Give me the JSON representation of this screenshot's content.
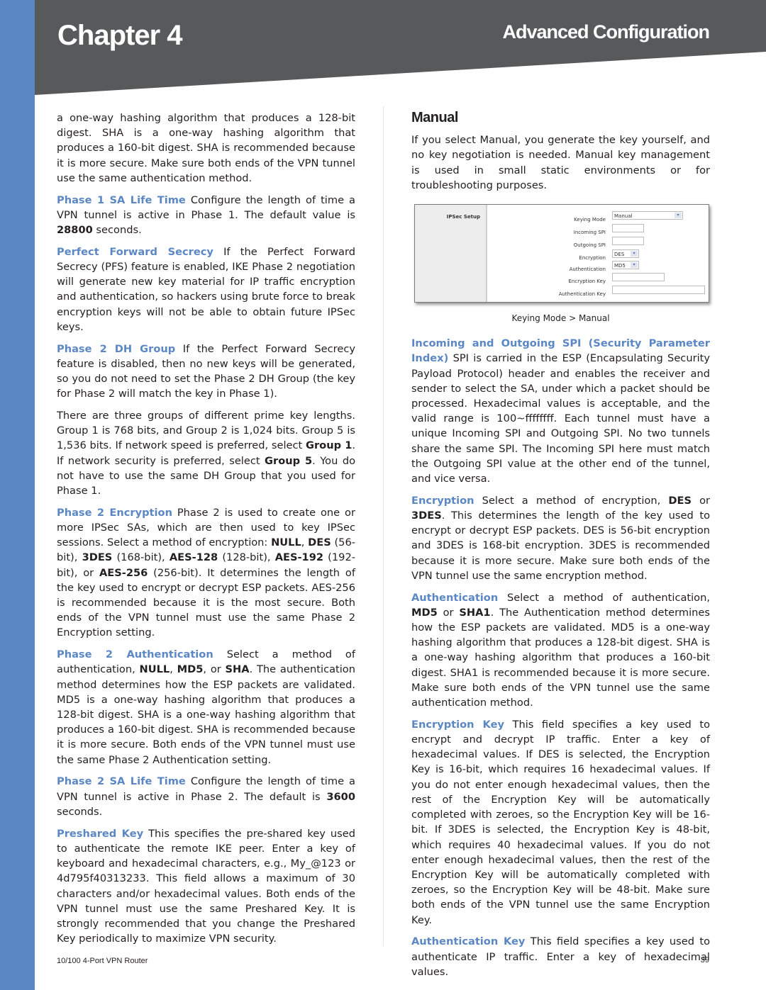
{
  "header": {
    "chapter": "Chapter 4",
    "section": "Advanced Configuration"
  },
  "left": {
    "p0": "a one-way hashing algorithm that produces a 128-bit digest. SHA is a one-way hashing algorithm that produces a 160-bit digest. SHA is recommended because it is more secure. Make sure both ends of the VPN tunnel use the same authentication method.",
    "p1_term": "Phase 1 SA Life Time",
    "p1_a": " Configure the length of time a VPN tunnel is active in Phase 1. The default value is ",
    "p1_b": "28800",
    "p1_c": " seconds.",
    "p2_term": "Perfect Forward Secrecy",
    "p2": " If the Perfect Forward Secrecy (PFS) feature is enabled, IKE Phase 2 negotiation will generate new key material for IP traffic encryption and authentication, so hackers using brute force to break encryption keys will not be able to obtain future IPSec keys.",
    "p3_term": "Phase 2 DH Group",
    "p3": " If the Perfect Forward Secrecy feature is disabled, then no new keys will be generated, so you do not need to set the Phase 2 DH Group (the key for Phase 2 will match the key in Phase 1).",
    "p4_a": "There are three groups of different prime key lengths. Group 1 is 768 bits, and Group 2 is 1,024 bits. Group 5 is 1,536 bits. If network speed is preferred, select ",
    "p4_b": "Group 1",
    "p4_c": ". If network security is preferred, select ",
    "p4_d": "Group 5",
    "p4_e": ". You do not have to use the same DH Group that you used for Phase 1.",
    "p5_term": "Phase 2 Encryption",
    "p5_a": " Phase 2 is used to create one or more IPSec SAs, which are then used to key IPSec sessions. Select a method of encryption: ",
    "p5_null": "NULL",
    "p5_s1": ", ",
    "p5_des": "DES",
    "p5_s2": " (56-bit), ",
    "p5_3des": "3DES",
    "p5_s3": " (168-bit), ",
    "p5_aes128": "AES-128",
    "p5_s4": " (128-bit), ",
    "p5_aes192": "AES-192",
    "p5_s5": " (192-bit), or ",
    "p5_aes256": "AES-256",
    "p5_b": " (256-bit). It determines the length of the key used to encrypt or decrypt ESP packets. AES-256 is recommended because it is the most secure. Both ends of the VPN tunnel must use the same Phase 2 Encryption setting.",
    "p6_term": "Phase 2 Authentication",
    "p6_a": " Select a method of authentication, ",
    "p6_null": "NULL",
    "p6_s1": ", ",
    "p6_md5": "MD5",
    "p6_s2": ", or ",
    "p6_sha": "SHA",
    "p6_b": ". The authentication method determines how the ESP packets are validated. MD5 is a one-way hashing algorithm that produces a 128-bit digest. SHA is a one-way hashing algorithm that produces a 160-bit digest. SHA is recommended because it is more secure. Both ends of the VPN tunnel must use the same Phase 2 Authentication setting.",
    "p7_term": "Phase 2 SA Life Time",
    "p7_a": " Configure the length of time a VPN tunnel is active in Phase 2. The default is ",
    "p7_b": "3600",
    "p7_c": " seconds.",
    "p8_term": "Preshared Key",
    "p8": " This specifies the pre-shared key used to authenticate the remote IKE peer. Enter a key of keyboard and hexadecimal characters, e.g., My_@123 or 4d795f40313233. This field allows a maximum of 30 characters and/or hexadecimal values. Both ends of the VPN tunnel must use the same Preshared Key. It is strongly recommended that you change the Preshared Key periodically to maximize VPN security."
  },
  "right": {
    "heading": "Manual",
    "intro": "If you select Manual, you generate the key yourself, and no key negotiation is needed. Manual key management is used in small static environments or for troubleshooting purposes.",
    "figure": {
      "pane_label": "IPSec Setup",
      "fields": [
        {
          "label": "Keying Mode",
          "value": "Manual"
        },
        {
          "label": "Incoming SPI",
          "value": ""
        },
        {
          "label": "Outgoing SPI",
          "value": ""
        },
        {
          "label": "Encryption",
          "value": "DES"
        },
        {
          "label": "Authentication",
          "value": "MD5"
        },
        {
          "label": "Encryption Key",
          "value": ""
        },
        {
          "label": "Authentication Key",
          "value": ""
        }
      ],
      "caption": "Keying Mode > Manual"
    },
    "r1_term": "Incoming and Outgoing SPI (Security Parameter Index)",
    "r1": " SPI is carried in the ESP (Encapsulating Security Payload Protocol) header and enables the receiver and sender to select the SA, under which a packet should be processed. Hexadecimal values is acceptable, and the valid range is 100~ffffffff. Each tunnel must have a unique Incoming SPI and Outgoing SPI. No two tunnels share the same SPI. The Incoming SPI here must match the Outgoing SPI value at the other end of the tunnel, and vice versa.",
    "r2_term": "Encryption",
    "r2_a": " Select a method of encryption, ",
    "r2_des": "DES",
    "r2_s1": " or ",
    "r2_3des": "3DES",
    "r2_b": ". This determines the length of the key used to encrypt or decrypt ESP packets. DES is 56-bit encryption and 3DES is 168-bit encryption. 3DES is recommended because it is more secure. Make sure both ends of the VPN tunnel use the same encryption method.",
    "r3_term": "Authentication",
    "r3_a": " Select a method of authentication, ",
    "r3_md5": "MD5",
    "r3_s1": " or ",
    "r3_sha1": "SHA1",
    "r3_b": ". The Authentication method determines how the ESP packets are validated. MD5 is a one-way hashing algorithm that produces a 128-bit digest. SHA is a one-way hashing algorithm that produces a 160-bit digest. SHA1 is recommended because it is more secure. Make sure both ends of the VPN tunnel use the same authentication method.",
    "r4_term": "Encryption Key",
    "r4": "  This field specifies a key used to encrypt and decrypt IP traffic. Enter a key of hexadecimal values. If DES is selected, the Encryption Key is 16-bit, which requires 16 hexadecimal values. If you do not enter enough hexadecimal values, then the rest of the Encryption Key will be automatically completed with zeroes, so the Encryption Key will be 16-bit. If 3DES is selected, the Encryption Key is 48-bit, which requires 40 hexadecimal values. If you do not enter enough hexadecimal values, then the rest of the Encryption Key will be automatically completed with zeroes, so the Encryption Key will be 48-bit. Make sure both ends of the VPN tunnel use the same Encryption Key.",
    "r5_term": "Authentication Key",
    "r5": " This field specifies a key used to authenticate IP traffic. Enter a key of hexadecimal values."
  },
  "footer": {
    "product": "10/100 4-Port VPN Router",
    "page": "39"
  },
  "colors": {
    "accent": "#5b87c5",
    "header_bg": "#58595b"
  }
}
